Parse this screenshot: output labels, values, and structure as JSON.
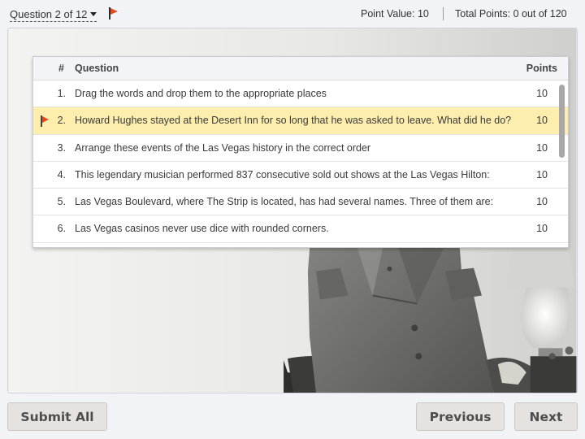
{
  "header": {
    "question_selector": "Question 2 of 12",
    "point_value": "Point Value: 10",
    "total_points": "Total Points: 0 out of 120"
  },
  "question_list": {
    "columns": {
      "number": "#",
      "question": "Question",
      "points": "Points"
    },
    "rows": [
      {
        "num": "1.",
        "text": "Drag the words and drop them to the appropriate places",
        "points": "10",
        "selected": false,
        "flagged": false
      },
      {
        "num": "2.",
        "text": "Howard Hughes stayed at the Desert Inn for so long that he was asked to leave. What did he do?",
        "points": "10",
        "selected": true,
        "flagged": true
      },
      {
        "num": "3.",
        "text": "Arrange these events of the Las Vegas history in the correct order",
        "points": "10",
        "selected": false,
        "flagged": false
      },
      {
        "num": "4.",
        "text": "This legendary musician performed 837 consecutive sold out shows at the Las Vegas Hilton:",
        "points": "10",
        "selected": false,
        "flagged": false
      },
      {
        "num": "5.",
        "text": "Las Vegas Boulevard, where The Strip is located, has had several names. Three of them are:",
        "points": "10",
        "selected": false,
        "flagged": false
      },
      {
        "num": "6.",
        "text": "Las Vegas casinos never use dice with rounded corners.",
        "points": "10",
        "selected": false,
        "flagged": false
      }
    ]
  },
  "footer": {
    "submit_all": "Submit All",
    "previous": "Previous",
    "next": "Next"
  },
  "colors": {
    "accent_flag": "#e34a1f",
    "selected_row": "#fdeeae",
    "button_bg": "#e5e2df"
  }
}
